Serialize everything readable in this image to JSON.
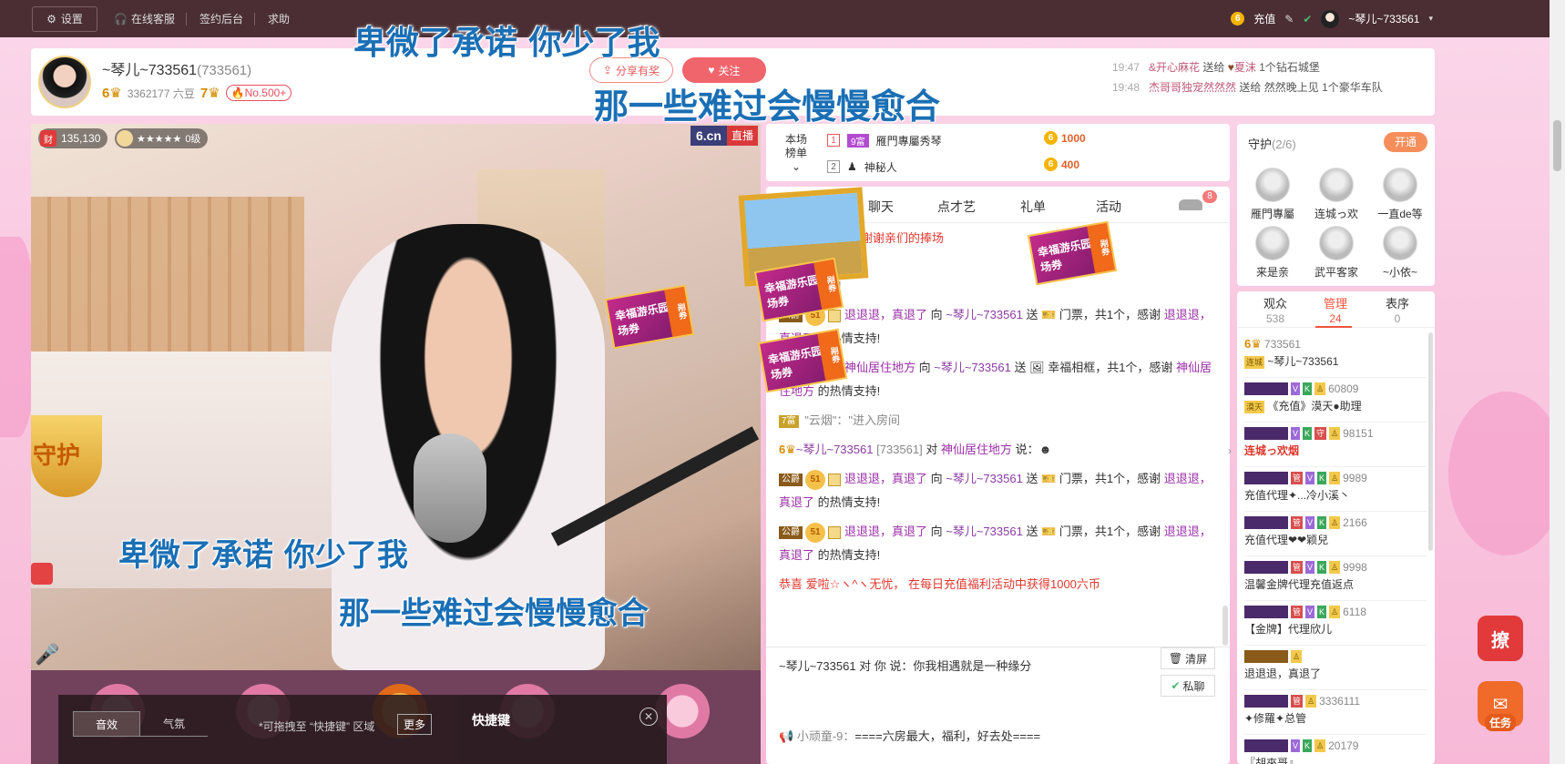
{
  "topbar": {
    "settings": "设置",
    "service": "在线客服",
    "signin": "签约后台",
    "help": "求助",
    "recharge": "充值",
    "user": "~琴儿~733561"
  },
  "anchor": {
    "name": "~琴儿~733561",
    "rid": "(733561)",
    "level_a": "6",
    "beans": "3362177 六豆",
    "level_b": "7",
    "rank": "No.500+",
    "share": "分享有奖",
    "follow": "关注"
  },
  "feed": [
    {
      "time": "19:47",
      "from": "&开心麻花",
      "verb": "送给",
      "to": "夏沫",
      "what": "1个钻石城堡"
    },
    {
      "time": "19:48",
      "from": "杰哥哥",
      "verb": "独宠然然然",
      "to": "送给 然然晚上见",
      "what": "1个豪华车队"
    }
  ],
  "lyrics": {
    "top1": "卑微了承诺  你少了我",
    "top2": "那一些难过会慢慢愈合",
    "video1": "卑微了承诺  你少了我",
    "video2": "那一些难过会慢慢愈合"
  },
  "video": {
    "wealth_tag": "财",
    "wealth": "135,130",
    "level": "0级",
    "logo": "6.cn",
    "live": "直播",
    "guard_text": "守护"
  },
  "sound": {
    "tab1": "音效",
    "tab2": "气氛",
    "hint": "*可拖拽至 “快捷键” 区域",
    "more": "更多"
  },
  "shortcut": {
    "title": "快捷键",
    "close": "✕"
  },
  "rank_card": {
    "label": "本场榜单",
    "rows": [
      {
        "num": "1",
        "badge": "9富",
        "name": "雁門專屬秀琴",
        "value": "1000"
      },
      {
        "num": "2",
        "badge": "",
        "name": "神秘人",
        "value": "400"
      }
    ]
  },
  "chat": {
    "tabs": [
      "聊天",
      "点才艺",
      "礼单",
      "活动"
    ],
    "car_count": "8",
    "welcome": "谢谢亲们的捧场",
    "msgs": [
      {
        "user": "退退退，真退了",
        "to": "~琴儿~733561",
        "text": "门票，共1个，感谢",
        "thanks": "退退退，真退了",
        "tail": "的热情支持!"
      },
      {
        "user": "退退退，真退了",
        "to": "~琴儿~733561",
        "text": "门票，共1个，感谢",
        "thanks": "退退退，真退了",
        "tail": "的热情支持!"
      },
      {
        "user": "神仙居住地方",
        "to": "~琴儿~733561",
        "text": "幸福相框，共1个，感谢",
        "thanks": "神仙居住地方",
        "tail": "的热情支持!"
      }
    ],
    "enter": {
      "badge": "7富",
      "user": "\"云烟\"",
      "text": "：\"进入房间"
    },
    "say": {
      "lvl": "6",
      "user": "~琴儿~733561",
      "rid": "[733561]",
      "to": "神仙居住地方",
      "verb": "说："
    },
    "msgs2": [
      {
        "user": "退退退，真退了",
        "to": "~琴儿~733561",
        "text": "门票，共1个，感谢",
        "thanks": "退退退，真退了",
        "tail": "的热情支持!"
      },
      {
        "user": "退退退，真退了",
        "to": "~琴儿~733561",
        "text": "门票，共1个，感谢",
        "thanks": "退退退，真退了",
        "tail": "的热情支持!"
      }
    ],
    "congrats": "恭喜 爱啦☆ヽ^ヽ无忧， 在每日充值福利活动中获得1000六币",
    "private": "~琴儿~733561 对 你 说：你我相遇就是一种缘分",
    "clear": "清屏",
    "pm": "私聊",
    "notice_user": "小顽童-9：",
    "notice": "====六房最大，福利，好去处===="
  },
  "guard": {
    "title": "守护",
    "count": "(2/6)",
    "open": "开通",
    "items": [
      "雁門專屬",
      "连城っ欢",
      "一直de等",
      "来是亲",
      "武平客家",
      "~小依~"
    ]
  },
  "users": {
    "tabs": [
      {
        "label": "观众",
        "count": "538"
      },
      {
        "label": "管理",
        "count": "24"
      },
      {
        "label": "表序",
        "count": "0"
      }
    ],
    "rows": [
      {
        "lvl": "6",
        "id": "733561",
        "name": "~琴儿~733561"
      },
      {
        "lvl": "",
        "id": "60809",
        "name": "《充值》漠天●助理"
      },
      {
        "lvl": "",
        "id": "98151",
        "name": "连城っ欢烟"
      },
      {
        "lvl": "",
        "id": "9989",
        "name": "充值代理✦...冷小溪丶"
      },
      {
        "lvl": "",
        "id": "2166",
        "name": "充值代理❤❤颖兒"
      },
      {
        "lvl": "",
        "id": "9998",
        "name": "温馨金牌代理充值返点"
      },
      {
        "lvl": "",
        "id": "6118",
        "name": "【金牌】代理欣儿"
      },
      {
        "lvl": "",
        "id": "",
        "name": "退退退，真退了"
      },
      {
        "lvl": "",
        "id": "3336111",
        "name": "✦修羅✦总管"
      },
      {
        "lvl": "",
        "id": "20179",
        "name": "『胡來哥』"
      }
    ]
  },
  "widgets": {
    "liao": "撩",
    "task": "任务"
  },
  "tickets": {
    "main": "幸福游乐园入场券",
    "side": "剐券"
  },
  "colors": {
    "topbar": "#4a2e33",
    "accent": "#f0646c",
    "page_bg": "#f9c9e1"
  }
}
